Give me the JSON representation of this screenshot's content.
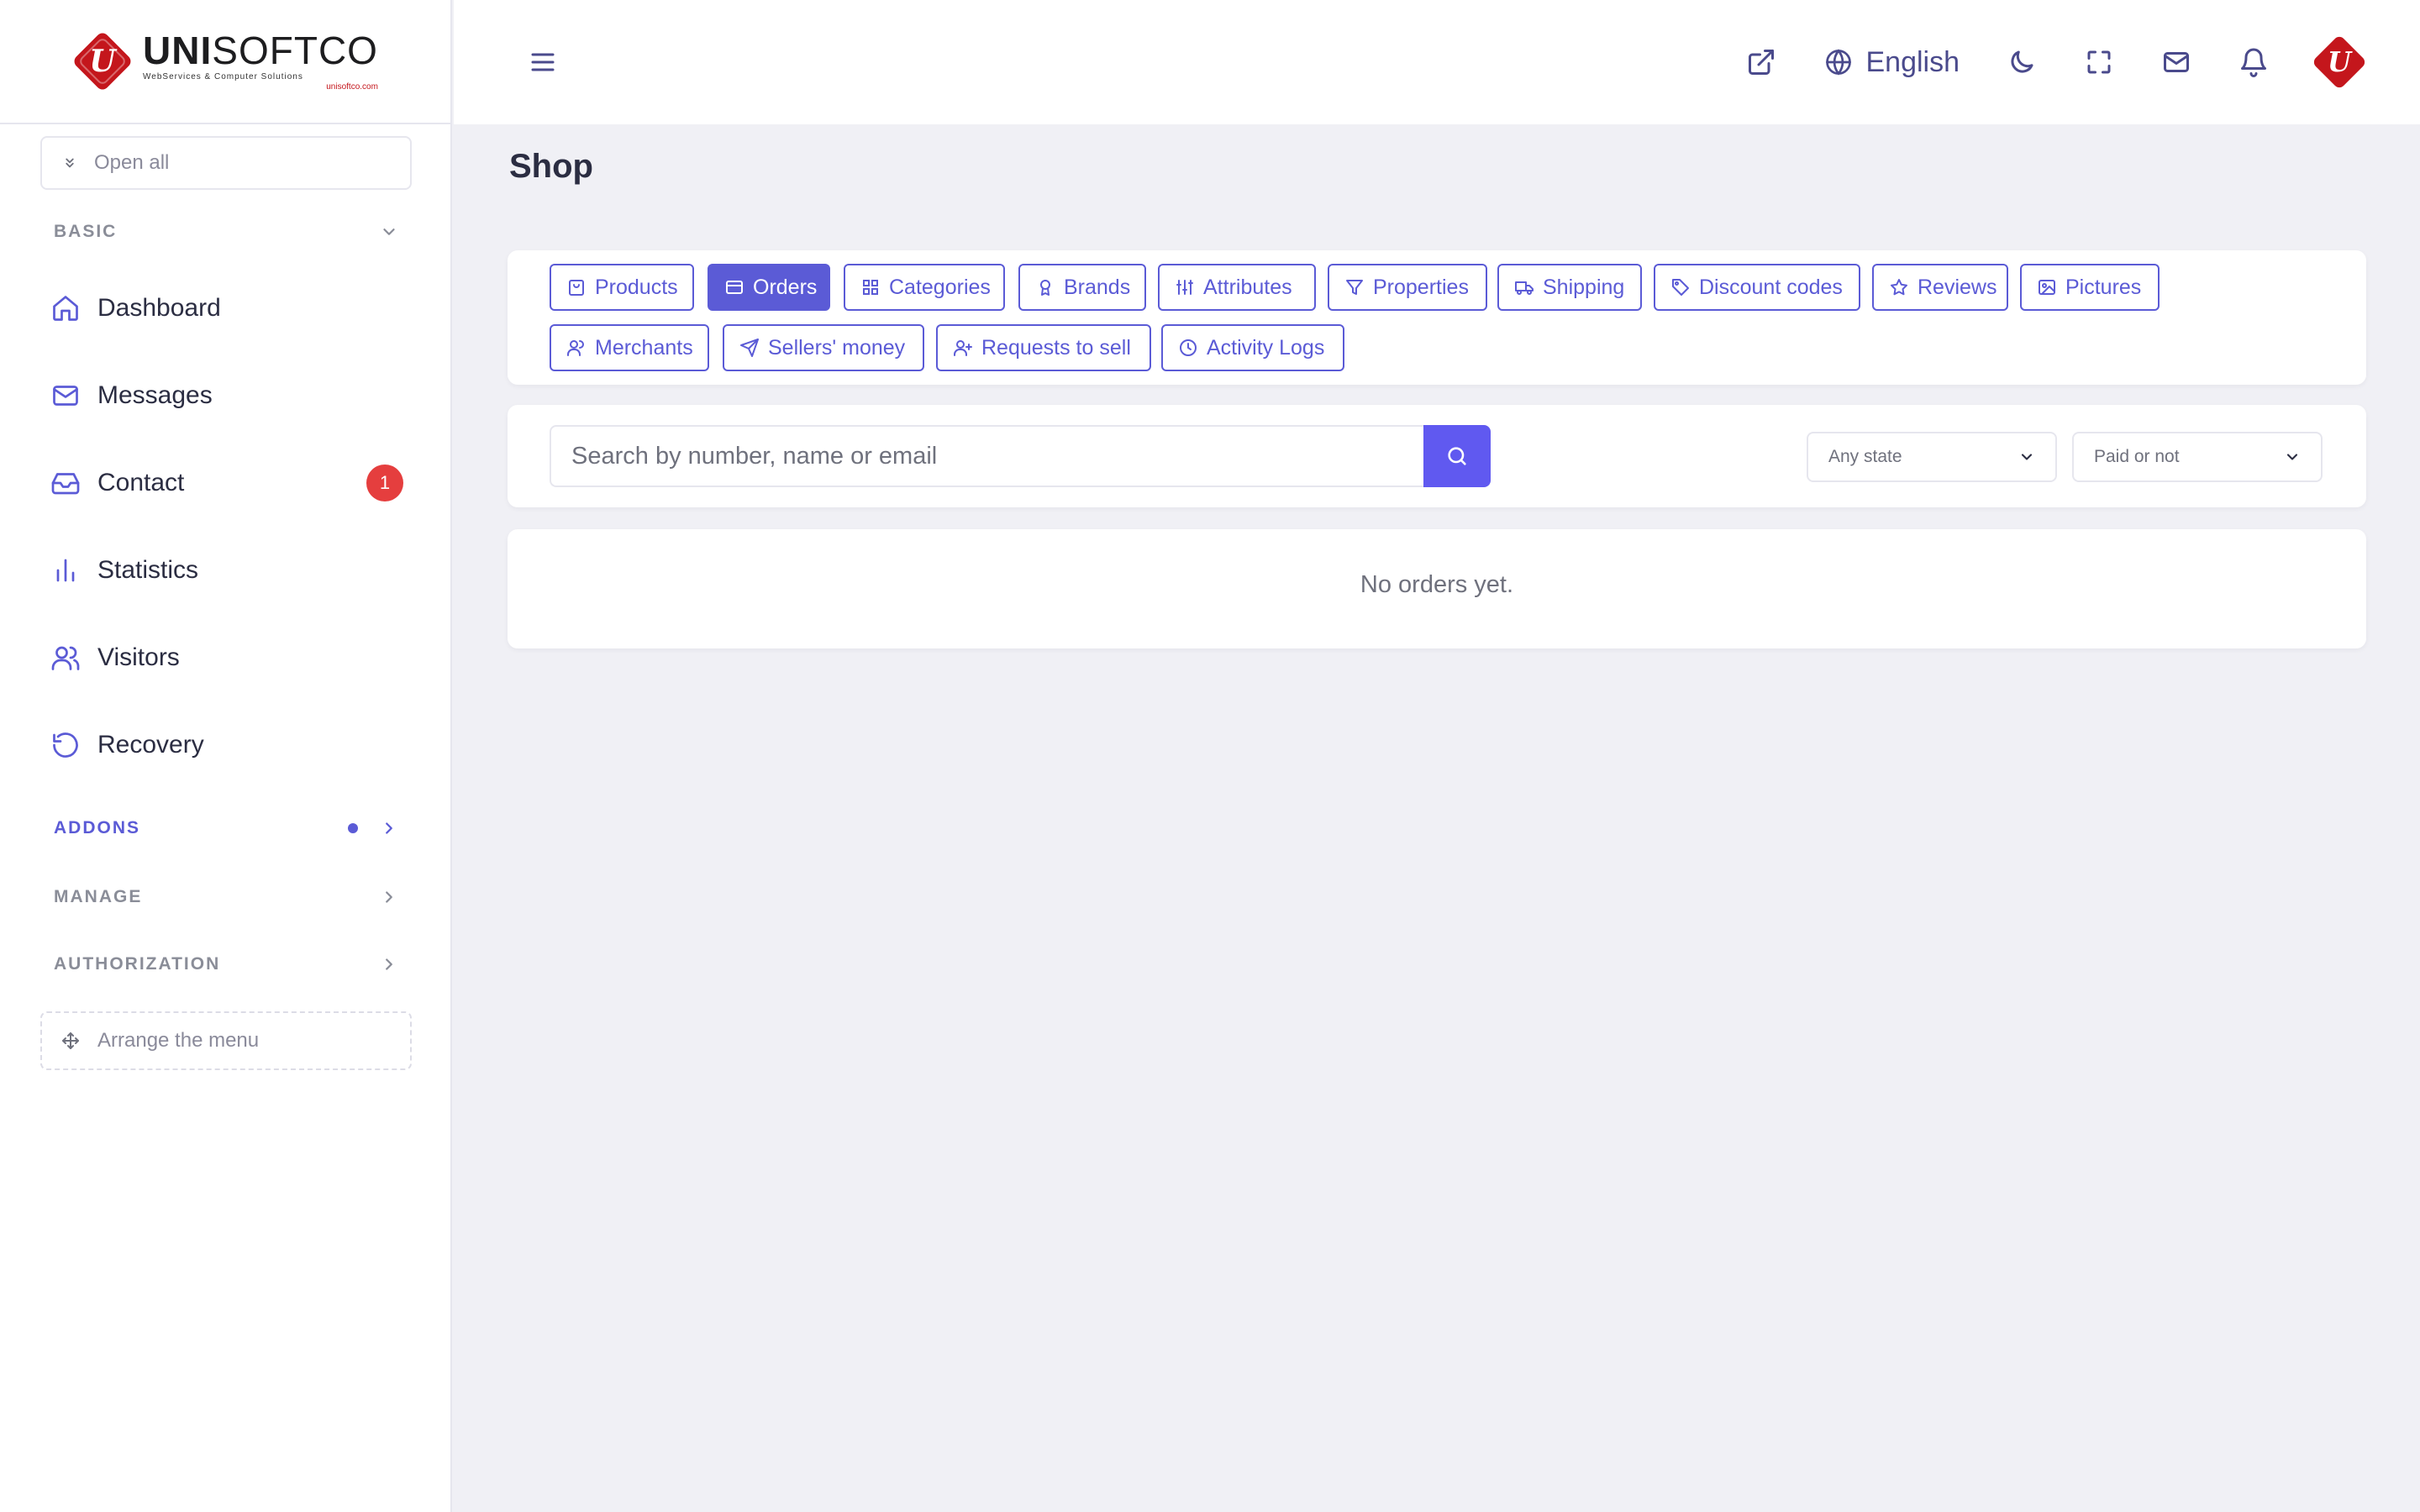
{
  "brand": {
    "name_bold": "UNI",
    "name_light": "SOFTCO",
    "tagline": "WebServices & Computer Solutions",
    "url": "unisoftco.com",
    "logo_letter": "U",
    "logo_color": "#c4161c"
  },
  "sidebar": {
    "open_all_label": "Open all",
    "basic_header": "BASIC",
    "items": [
      {
        "label": "Dashboard",
        "icon": "home-icon"
      },
      {
        "label": "Messages",
        "icon": "mail-icon"
      },
      {
        "label": "Contact",
        "icon": "inbox-icon",
        "badge": "1"
      },
      {
        "label": "Statistics",
        "icon": "bar-chart-icon"
      },
      {
        "label": "Visitors",
        "icon": "users-icon"
      },
      {
        "label": "Recovery",
        "icon": "history-icon"
      }
    ],
    "addons_header": "ADDONS",
    "manage_header": "MANAGE",
    "authorization_header": "AUTHORIZATION",
    "arrange_label": "Arrange the menu"
  },
  "topbar": {
    "language": "English",
    "icons": [
      "external-link-icon",
      "globe-icon",
      "moon-icon",
      "fullscreen-icon",
      "mail-icon",
      "bell-icon"
    ]
  },
  "page": {
    "title": "Shop"
  },
  "tabs": [
    {
      "label": "Products",
      "icon": "bag-icon",
      "active": false
    },
    {
      "label": "Orders",
      "icon": "credit-card-icon",
      "active": true
    },
    {
      "label": "Categories",
      "icon": "grid-icon",
      "active": false
    },
    {
      "label": "Brands",
      "icon": "award-icon",
      "active": false
    },
    {
      "label": "Attributes",
      "icon": "sliders-icon",
      "active": false
    },
    {
      "label": "Properties",
      "icon": "filter-icon",
      "active": false
    },
    {
      "label": "Shipping",
      "icon": "truck-icon",
      "active": false
    },
    {
      "label": "Discount codes",
      "icon": "tag-icon",
      "active": false
    },
    {
      "label": "Reviews",
      "icon": "star-icon",
      "active": false
    },
    {
      "label": "Pictures",
      "icon": "image-icon",
      "active": false
    },
    {
      "label": "Merchants",
      "icon": "users-icon",
      "active": false
    },
    {
      "label": "Sellers' money",
      "icon": "send-icon",
      "active": false
    },
    {
      "label": "Requests to sell",
      "icon": "user-plus-icon",
      "active": false
    },
    {
      "label": "Activity Logs",
      "icon": "clock-icon",
      "active": false
    }
  ],
  "search": {
    "placeholder": "Search by number, name or email",
    "value": "",
    "state_select": "Any state",
    "paid_select": "Paid or not"
  },
  "orders": {
    "empty_message": "No orders yet."
  },
  "colors": {
    "accent": "#5b5bd6",
    "search_button": "#6059f0",
    "badge": "#e53e3e",
    "background": "#f0f0f5"
  }
}
